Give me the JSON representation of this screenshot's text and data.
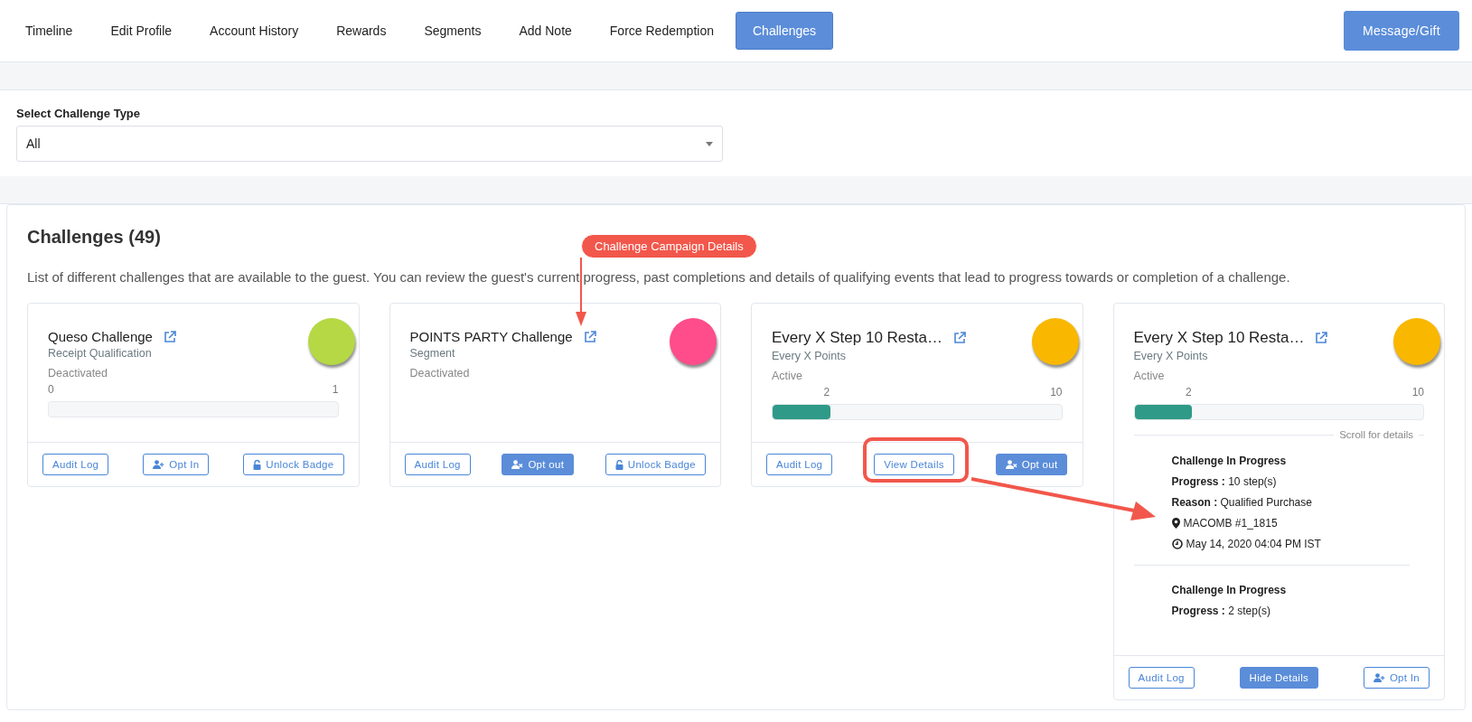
{
  "tabs": [
    {
      "label": "Timeline",
      "selected": false
    },
    {
      "label": "Edit Profile",
      "selected": false
    },
    {
      "label": "Account History",
      "selected": false
    },
    {
      "label": "Rewards",
      "selected": false
    },
    {
      "label": "Segments",
      "selected": false
    },
    {
      "label": "Add Note",
      "selected": false
    },
    {
      "label": "Force Redemption",
      "selected": false
    },
    {
      "label": "Challenges",
      "selected": true
    }
  ],
  "action_button": "Message/Gift",
  "filter": {
    "label": "Select Challenge Type",
    "value": "All"
  },
  "panel": {
    "title": "Challenges (49)",
    "description": "List of different challenges that are available to the guest. You can review the guest's current progress, past completions and details of qualifying events that lead to progress towards or completion of a challenge.",
    "cards": [
      {
        "name": "Queso Challenge",
        "type": "Receipt Qualification",
        "status": "Deactivated",
        "color": "#b5d844",
        "progress": {
          "min": "0",
          "max": "1"
        },
        "buttons": [
          {
            "label": "Audit Log",
            "kind": "plain"
          },
          {
            "label": "Opt In",
            "kind": "optin"
          },
          {
            "label": "Unlock Badge",
            "kind": "unlock"
          }
        ]
      },
      {
        "name": "POINTS PARTY Challenge",
        "type": "Segment",
        "status": "Deactivated",
        "color": "#ff4c8b",
        "buttons": [
          {
            "label": "Audit Log",
            "kind": "plain"
          },
          {
            "label": "Opt out",
            "kind": "optout"
          },
          {
            "label": "Unlock Badge",
            "kind": "unlock"
          }
        ]
      },
      {
        "name": "Every X Step 10 Resta…",
        "type": "Every X Points",
        "status": "Active",
        "color": "#f9b700",
        "progress": {
          "current": "2",
          "max": "10",
          "level": 0.2
        },
        "buttons": [
          {
            "label": "Audit Log",
            "kind": "plain"
          },
          {
            "label": "View Details",
            "kind": "plain"
          },
          {
            "label": "Opt out",
            "kind": "optout"
          }
        ]
      },
      {
        "name": "Every X Step 10 Resta…",
        "type": "Every X Points",
        "status": "Active",
        "color": "#f9b700",
        "progress": {
          "current": "2",
          "max": "10",
          "level": 0.2
        },
        "details": {
          "hint": "Scroll for details",
          "entries": [
            {
              "title": "Challenge In Progress",
              "progress_label": "Progress :",
              "progress": "10 step(s)",
              "reason_label": "Reason :",
              "reason": "Qualified Purchase",
              "location": "MACOMB #1_1815",
              "time": "May 14, 2020 04:04 PM IST"
            },
            {
              "title": "Challenge In Progress",
              "progress_label": "Progress :",
              "progress": "2 step(s)"
            }
          ]
        },
        "buttons": [
          {
            "label": "Audit Log",
            "kind": "plain"
          },
          {
            "label": "Hide Details",
            "kind": "action"
          },
          {
            "label": "Opt In",
            "kind": "optin"
          }
        ]
      }
    ]
  },
  "annotations": [
    {
      "kind": "callout",
      "label": "Challenge Campaign Details"
    },
    {
      "kind": "highlight"
    }
  ]
}
